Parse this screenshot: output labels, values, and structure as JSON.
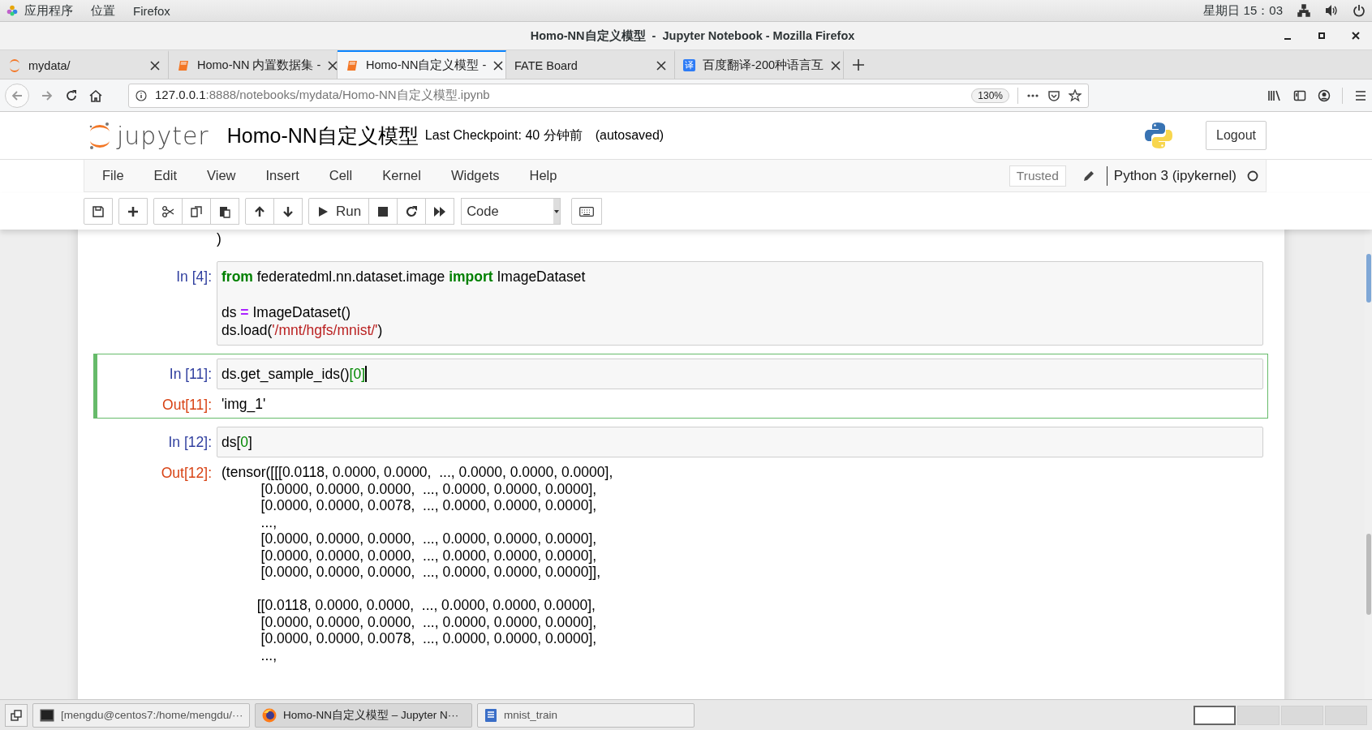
{
  "desktop_bar": {
    "menus": [
      "应用程序",
      "位置",
      "Firefox"
    ],
    "clock": "星期日 15：03"
  },
  "window": {
    "title": "Homo-NN自定义模型  -  Jupyter Notebook - Mozilla Firefox"
  },
  "tabs": [
    {
      "label": "mydata/",
      "kind": "folder",
      "selected": false
    },
    {
      "label": "Homo-NN 内置数据集 -",
      "kind": "notebook",
      "selected": false
    },
    {
      "label": "Homo-NN自定义模型 -",
      "kind": "notebook",
      "selected": true
    },
    {
      "label": "FATE Board",
      "kind": "plain",
      "selected": false
    },
    {
      "label": "百度翻译-200种语言互",
      "kind": "translator",
      "icon_text": "译",
      "selected": false
    }
  ],
  "address_bar": {
    "host": "127.0.0.1",
    "path": ":8888/notebooks/mydata/Homo-NN自定义模型.ipynb",
    "zoom": "130%"
  },
  "notebook_header": {
    "logo_text": "jupyter",
    "name": "Homo-NN自定义模型",
    "checkpoint": "Last Checkpoint: 40 分钟前",
    "autosave": "(autosaved)",
    "logout": "Logout"
  },
  "menu": [
    "File",
    "Edit",
    "View",
    "Insert",
    "Cell",
    "Kernel",
    "Widgets",
    "Help"
  ],
  "kernel": {
    "trusted": "Trusted",
    "name": "Python 3 (ipykernel)",
    "busy": false
  },
  "toolbar": {
    "run": "Run",
    "cell_type": "Code"
  },
  "cells": [
    {
      "kind": "tail",
      "code": [
        [
          {
            "tokens": [
              {
                "kind": "plain",
                "text": ")"
              }
            ]
          }
        ]
      ]
    },
    {
      "kind": "code",
      "selected": false,
      "prompt": "In [4]:",
      "code": [
        [
          {
            "tokens": [
              {
                "kind": "kw",
                "text": "from"
              },
              {
                "kind": "plain",
                "text": " federatedml.nn.dataset.image "
              },
              {
                "kind": "kw",
                "text": "import"
              },
              {
                "kind": "plain",
                "text": " ImageDataset"
              }
            ]
          }
        ],
        [
          {
            "tokens": [
              {
                "kind": "plain",
                "text": "ds "
              },
              {
                "kind": "op",
                "text": "="
              },
              {
                "kind": "plain",
                "text": " ImageDataset()"
              }
            ]
          },
          {
            "tokens": [
              {
                "kind": "plain",
                "text": "ds.load("
              },
              {
                "kind": "str",
                "text": "'/mnt/hgfs/mnist/'"
              },
              {
                "kind": "plain",
                "text": ")"
              }
            ]
          }
        ]
      ]
    },
    {
      "kind": "code",
      "selected": true,
      "prompt": "In [11]:",
      "code": [
        [
          {
            "tokens": [
              {
                "kind": "plain",
                "text": "ds.get_sample_ids()"
              },
              {
                "kind": "num",
                "text": "[0]"
              }
            ]
          }
        ]
      ],
      "out_prompt": "Out[11]:",
      "output": [
        [
          "'img_1'"
        ]
      ]
    },
    {
      "kind": "code",
      "selected": false,
      "prompt": "In [12]:",
      "code": [
        [
          {
            "tokens": [
              {
                "kind": "plain",
                "text": "ds["
              },
              {
                "kind": "num",
                "text": "0"
              },
              {
                "kind": "plain",
                "text": "]"
              }
            ]
          }
        ]
      ],
      "out_prompt": "Out[12]:",
      "output": [
        [
          "(tensor([[[0.0118, 0.0000, 0.0000,  ..., 0.0000, 0.0000, 0.0000],",
          "          [0.0000, 0.0000, 0.0000,  ..., 0.0000, 0.0000, 0.0000],",
          "          [0.0000, 0.0000, 0.0078,  ..., 0.0000, 0.0000, 0.0000],",
          "          ...,",
          "          [0.0000, 0.0000, 0.0000,  ..., 0.0000, 0.0000, 0.0000],",
          "          [0.0000, 0.0000, 0.0000,  ..., 0.0000, 0.0000, 0.0000],",
          "          [0.0000, 0.0000, 0.0000,  ..., 0.0000, 0.0000, 0.0000]],"
        ],
        [
          "         [[0.0118, 0.0000, 0.0000,  ..., 0.0000, 0.0000, 0.0000],",
          "          [0.0000, 0.0000, 0.0000,  ..., 0.0000, 0.0000, 0.0000],",
          "          [0.0000, 0.0000, 0.0078,  ..., 0.0000, 0.0000, 0.0000],",
          "          ...,"
        ]
      ]
    }
  ],
  "taskbar": {
    "items": [
      {
        "label": "[mengdu@centos7:/home/mengdu/···",
        "kind": "terminal",
        "selected": false
      },
      {
        "label": "Homo-NN自定义模型 – Jupyter N···",
        "kind": "browser",
        "selected": true
      },
      {
        "label": "mnist_train",
        "kind": "file",
        "selected": false
      }
    ],
    "workspaces": [
      {
        "selected": true
      },
      {
        "selected": false
      },
      {
        "selected": false
      },
      {
        "selected": false
      }
    ]
  }
}
